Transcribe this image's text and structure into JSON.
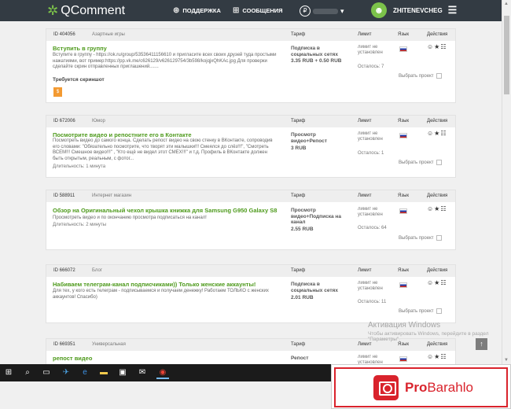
{
  "header": {
    "logo": "QComment",
    "nav_support": "ПОДДЕРЖКА",
    "nav_messages": "СООБЩЕНИЯ",
    "balance_symbol": "₽",
    "username": "ZHITENEVCHEG"
  },
  "columns": {
    "tariff": "Тариф",
    "limit": "Лимит",
    "lang": "Язык",
    "actions": "Действия"
  },
  "tasks": [
    {
      "id": "ID 404056",
      "category": "Азартные игры",
      "title": "Вступить в группу",
      "desc": "Вступите в группу - https://ok.ru/group/53536411156610 и пригласите всех своих друзей туда простыми нажатиями, вот пример:https://pp.vk.me/c626129/v626129754/3b598/kojqjxQhKAc.jpg Для проверки сделайте скрин отправленных приглашений.......",
      "note": "Требуется скриншот",
      "badge": "$",
      "tariff": "Подписка в социальных сетях",
      "price": "3.35 RUB + 0.50 RUB",
      "limit": "лимит не установлен",
      "remaining": "Осталось: 7",
      "select": "Выбрать проект"
    },
    {
      "id": "ID 672006",
      "category": "Юмор",
      "title": "Посмотрите видео и репостните его в Контакте",
      "desc": "Посмотреть видео до самого конца. Сделать репост видео на свою стенку в ВКонтакте, сопроводив его словами: \"Обязательно посмотрите, что творят эти малышки!!! Смеялся до слёз!!!\", \"Смотреть ВСЕМ!!! Смешное видео!!!\" , \"Кто ещё не видел этот СМЕХ!!!\" и т.д. Профиль в ВКонтакте должен быть открытым, реальным, с фотог...",
      "duration": "Длительность: 1 минута",
      "tariff": "Просмотр видео+Репост",
      "price": "3 RUB",
      "limit": "лимит не установлен",
      "remaining": "Осталось: 1",
      "select": "Выбрать проект"
    },
    {
      "id": "ID 588911",
      "category": "Интернет магазин",
      "title": "Обзор на Оригинальный чехол крышка книжка для Samsung G950 Galaxy S8",
      "desc": "Просмотреть видео и по окончанию просмотра подписаться на канал!",
      "duration": "Длительность: 2 минуты",
      "tariff": "Просмотр видео+Подписка на канал",
      "price": "2.55 RUB",
      "limit": "лимит не установлен",
      "remaining": "Осталось: 64",
      "select": "Выбрать проект"
    },
    {
      "id": "ID 666072",
      "category": "Блог",
      "title": "Набиваем телеграм-канал подписчиками)) Только женские аккаунты!",
      "desc": "Для тех, у кого есть телеграм - подписываемся и получаем денежку! Работаем ТОЛЬКО с женских аккаунтов! Спасибо)",
      "tariff": "Подписка в социальных сетях",
      "price": "2.01 RUB",
      "limit": "лимит не установлен",
      "remaining": "Осталось: 11",
      "select": "Выбрать проект"
    },
    {
      "id": "ID 669351",
      "category": "Универсальная",
      "title": "репост видео",
      "tariff": "Репост",
      "limit": "лимит не установлен"
    }
  ],
  "watermark": {
    "line1": "Активация Windows",
    "line2": "Чтобы активировать Windows, перейдите в раздел \"Параметры\"."
  },
  "ad": {
    "brand_pro": "Pro",
    "brand_rest": "Barahlo"
  },
  "colors": {
    "topbar": "#333b43",
    "title_green": "#4e9a1c",
    "badge_orange": "#f39a32",
    "ad_red": "#d9232c"
  }
}
